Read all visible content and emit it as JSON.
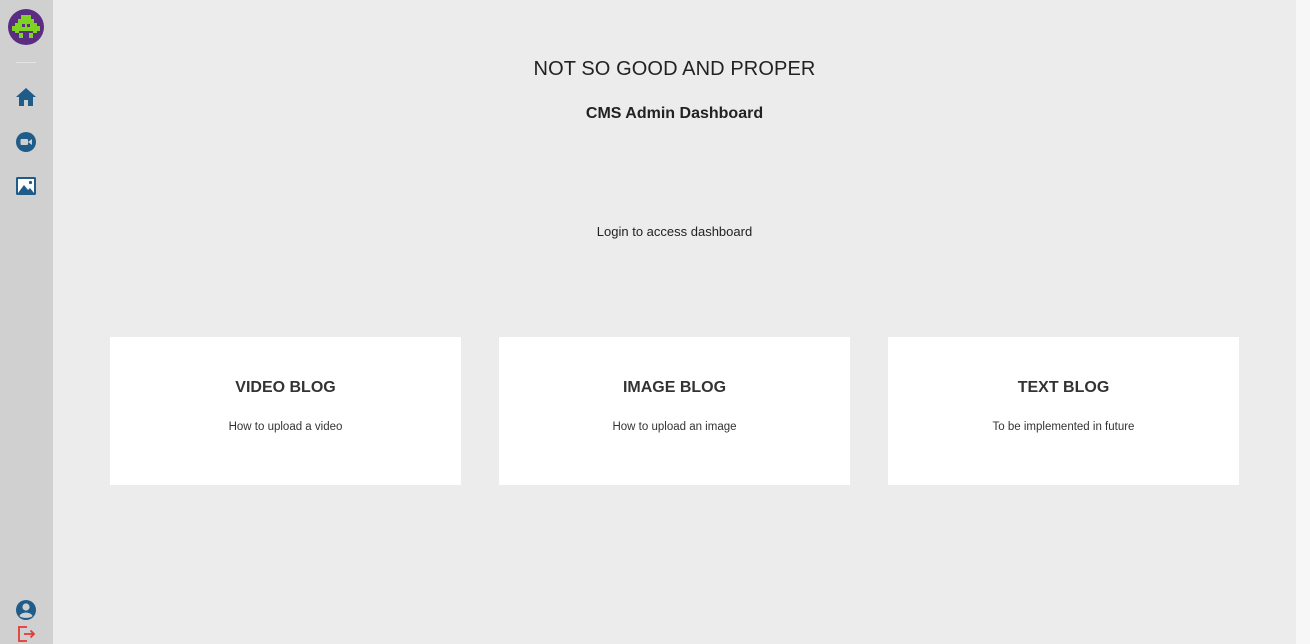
{
  "header": {
    "site_title": "NOT SO GOOD AND PROPER",
    "subtitle": "CMS Admin Dashboard"
  },
  "main": {
    "login_message": "Login to access dashboard",
    "cards": [
      {
        "title": "VIDEO BLOG",
        "description": "How to upload a video"
      },
      {
        "title": "IMAGE BLOG",
        "description": "How to upload an image"
      },
      {
        "title": "TEXT BLOG",
        "description": "To be implemented in future"
      }
    ]
  },
  "sidebar": {
    "logo_icon": "space-invader-logo",
    "nav_icons": [
      "home-icon",
      "video-camera-icon",
      "image-icon"
    ],
    "bottom_icons": [
      "user-account-icon",
      "logout-icon"
    ]
  },
  "colors": {
    "sidebar_bg": "#d0d0d0",
    "page_bg": "#ececec",
    "card_bg": "#ffffff",
    "icon_blue": "#1f5c8a",
    "logo_bg": "#5a2d82",
    "logo_green": "#7fd321",
    "logout_red": "#e53935"
  }
}
